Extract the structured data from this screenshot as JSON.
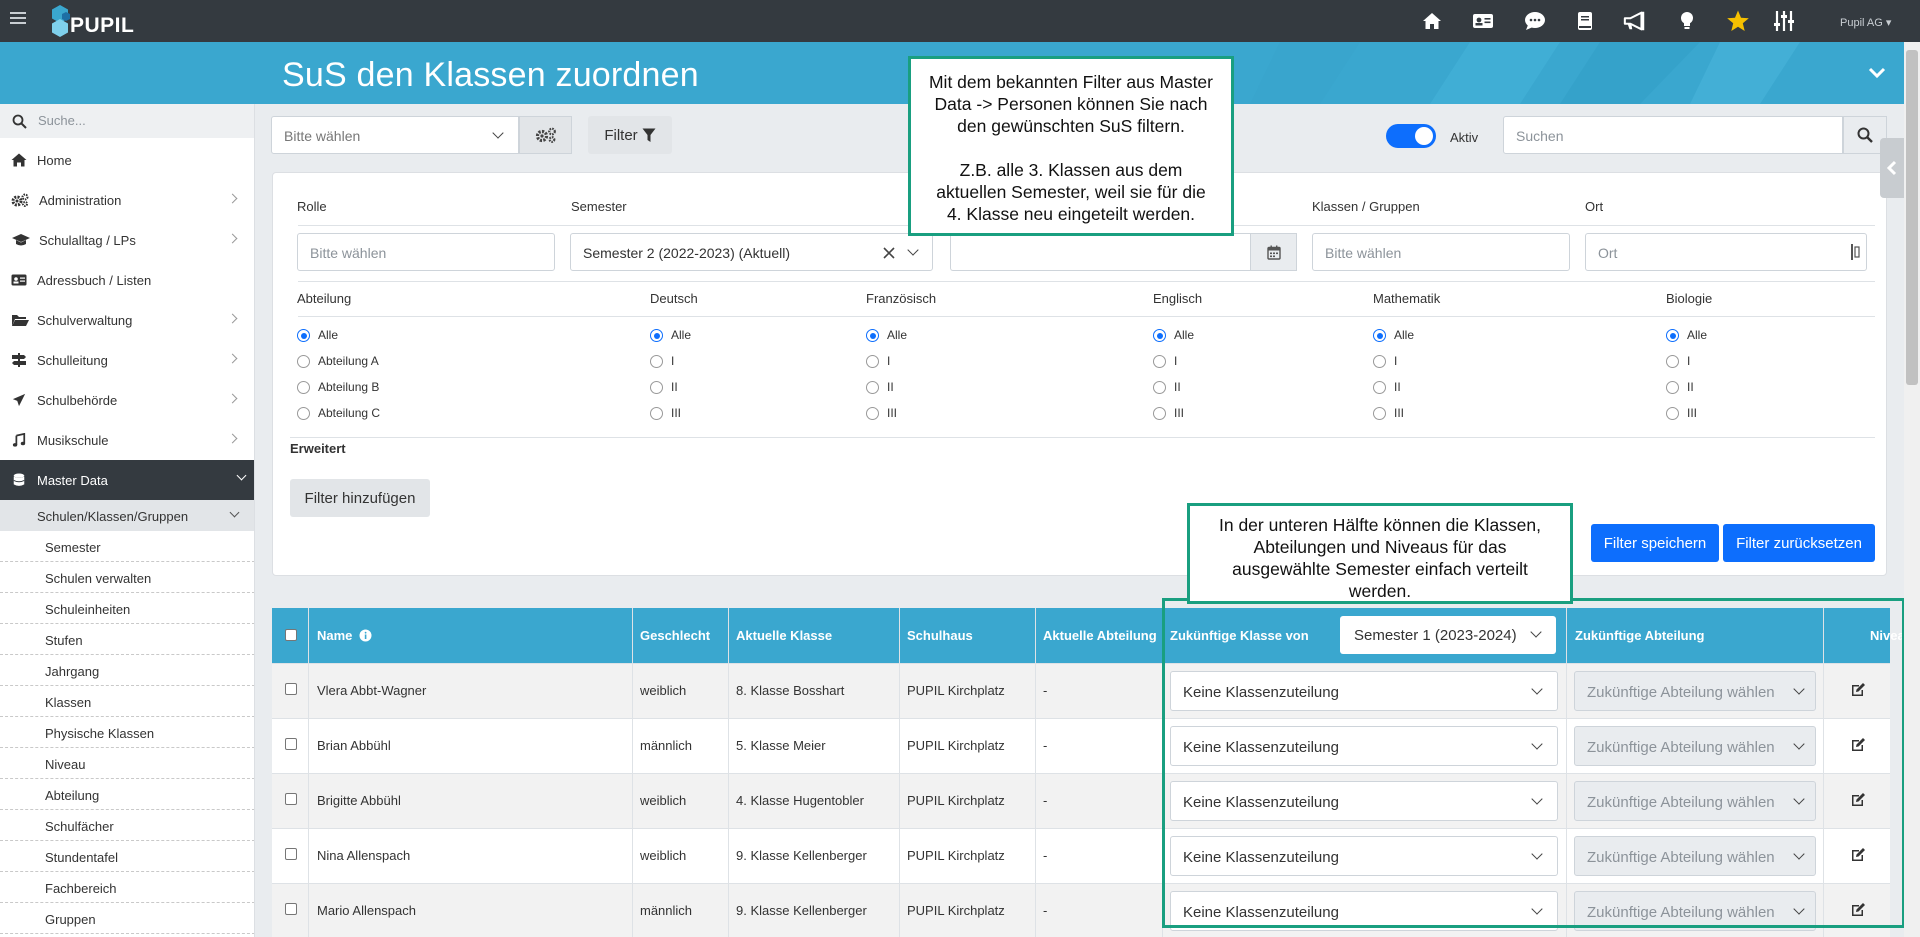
{
  "app": {
    "logo_text": "PUPIL",
    "user": "Pupil AG"
  },
  "topbar": {
    "icons": [
      "home-icon",
      "id-card-icon",
      "chat-icon",
      "book-icon",
      "megaphone-icon",
      "lightbulb-icon",
      "star-icon",
      "sliders-icon"
    ],
    "star_color": "#f6c000"
  },
  "page": {
    "title": "SuS den Klassen zuordnen"
  },
  "sidebar": {
    "search_placeholder": "Suche...",
    "items": [
      {
        "label": "Home",
        "icon": "home-icon"
      },
      {
        "label": "Administration",
        "icon": "cogs-icon"
      },
      {
        "label": "Schulalltag / LPs",
        "icon": "graduation-cap-icon"
      },
      {
        "label": "Adressbuch / Listen",
        "icon": "address-card-icon"
      },
      {
        "label": "Schulverwaltung",
        "icon": "folder-open-icon"
      },
      {
        "label": "Schulleitung",
        "icon": "signpost-icon"
      },
      {
        "label": "Schulbehörde",
        "icon": "paper-plane-icon"
      },
      {
        "label": "Musikschule",
        "icon": "music-icon"
      },
      {
        "label": "Master Data",
        "icon": "database-icon"
      }
    ],
    "subgroup": "Schulen/Klassen/Gruppen",
    "subitems": [
      "Semester",
      "Schulen verwalten",
      "Schuleinheiten",
      "Stufen",
      "Jahrgang",
      "Klassen",
      "Physische Klassen",
      "Niveau",
      "Abteilung",
      "Schulfächer",
      "Stundentafel",
      "Fachbereich",
      "Gruppen"
    ]
  },
  "toolbar": {
    "select_placeholder": "Bitte wählen",
    "filter_label": "Filter",
    "toggle_label": "Aktiv",
    "search_placeholder": "Suchen"
  },
  "filter": {
    "labels": {
      "rolle": "Rolle",
      "semester": "Semester",
      "klassen": "Klassen / Gruppen",
      "ort": "Ort"
    },
    "rolle_placeholder": "Bitte wählen",
    "semester_value": "Semester 2 (2022-2023) (Aktuell)",
    "klassen_placeholder": "Bitte wählen",
    "ort_placeholder": "Ort",
    "groups": [
      {
        "title": "Abteilung",
        "options": [
          "Alle",
          "Abteilung A",
          "Abteilung B",
          "Abteilung C"
        ]
      },
      {
        "title": "Deutsch",
        "options": [
          "Alle",
          "I",
          "II",
          "III"
        ]
      },
      {
        "title": "Französisch",
        "options": [
          "Alle",
          "I",
          "II",
          "III"
        ]
      },
      {
        "title": "Englisch",
        "options": [
          "Alle",
          "I",
          "II",
          "III"
        ]
      },
      {
        "title": "Mathematik",
        "options": [
          "Alle",
          "I",
          "II",
          "III"
        ]
      },
      {
        "title": "Biologie",
        "options": [
          "Alle",
          "I",
          "II",
          "III"
        ]
      }
    ],
    "advanced": "Erweitert",
    "add_filter": "Filter hinzufügen",
    "save": "Filter speichern",
    "reset": "Filter zurücksetzen"
  },
  "table": {
    "headers": {
      "name": "Name",
      "geschlecht": "Geschlecht",
      "aktuelle_klasse": "Aktuelle Klasse",
      "schulhaus": "Schulhaus",
      "aktuelle_abteilung": "Aktuelle Abteilung",
      "zukuenftige_klasse": "Zukünftige Klasse von",
      "zukuenftige_abteilung": "Zukünftige Abteilung",
      "niveau": "Niveau"
    },
    "semester_select": "Semester 1 (2023-2024)",
    "rows": [
      {
        "name": "Vlera Abbt-Wagner",
        "geschlecht": "weiblich",
        "klasse": "8. Klasse Bosshart",
        "schulhaus": "PUPIL Kirchplatz",
        "abteilung": "-",
        "zuk_klasse": "Keine Klassenzuteilung",
        "zuk_abteilung": "Zukünftige Abteilung wählen"
      },
      {
        "name": "Brian Abbühl",
        "geschlecht": "männlich",
        "klasse": "5. Klasse Meier",
        "schulhaus": "PUPIL Kirchplatz",
        "abteilung": "-",
        "zuk_klasse": "Keine Klassenzuteilung",
        "zuk_abteilung": "Zukünftige Abteilung wählen"
      },
      {
        "name": "Brigitte Abbühl",
        "geschlecht": "weiblich",
        "klasse": "4. Klasse Hugentobler",
        "schulhaus": "PUPIL Kirchplatz",
        "abteilung": "-",
        "zuk_klasse": "Keine Klassenzuteilung",
        "zuk_abteilung": "Zukünftige Abteilung wählen"
      },
      {
        "name": "Nina Allenspach",
        "geschlecht": "weiblich",
        "klasse": "9. Klasse Kellenberger",
        "schulhaus": "PUPIL Kirchplatz",
        "abteilung": "-",
        "zuk_klasse": "Keine Klassenzuteilung",
        "zuk_abteilung": "Zukünftige Abteilung wählen"
      },
      {
        "name": "Mario Allenspach",
        "geschlecht": "männlich",
        "klasse": "9. Klasse Kellenberger",
        "schulhaus": "PUPIL Kirchplatz",
        "abteilung": "-",
        "zuk_klasse": "Keine Klassenzuteilung",
        "zuk_abteilung": "Zukünftige Abteilung wählen"
      }
    ]
  },
  "callouts": {
    "top": [
      "Mit dem bekannten Filter aus Master",
      "Data -> Personen können Sie nach",
      "den gewünschten SuS filtern.",
      "",
      "Z.B. alle 3. Klassen aus dem",
      "aktuellen Semester, weil sie für die",
      "4. Klasse neu eingeteilt werden."
    ],
    "bottom": [
      "In der unteren Hälfte können die Klassen,",
      "Abteilungen und Niveaus für das",
      "ausgewählte Semester einfach verteilt",
      "werden."
    ],
    "border_color": "#199f80"
  },
  "colors": {
    "accent": "#3aa7cf",
    "primary": "#0d6efd",
    "topbar": "#343a40"
  }
}
